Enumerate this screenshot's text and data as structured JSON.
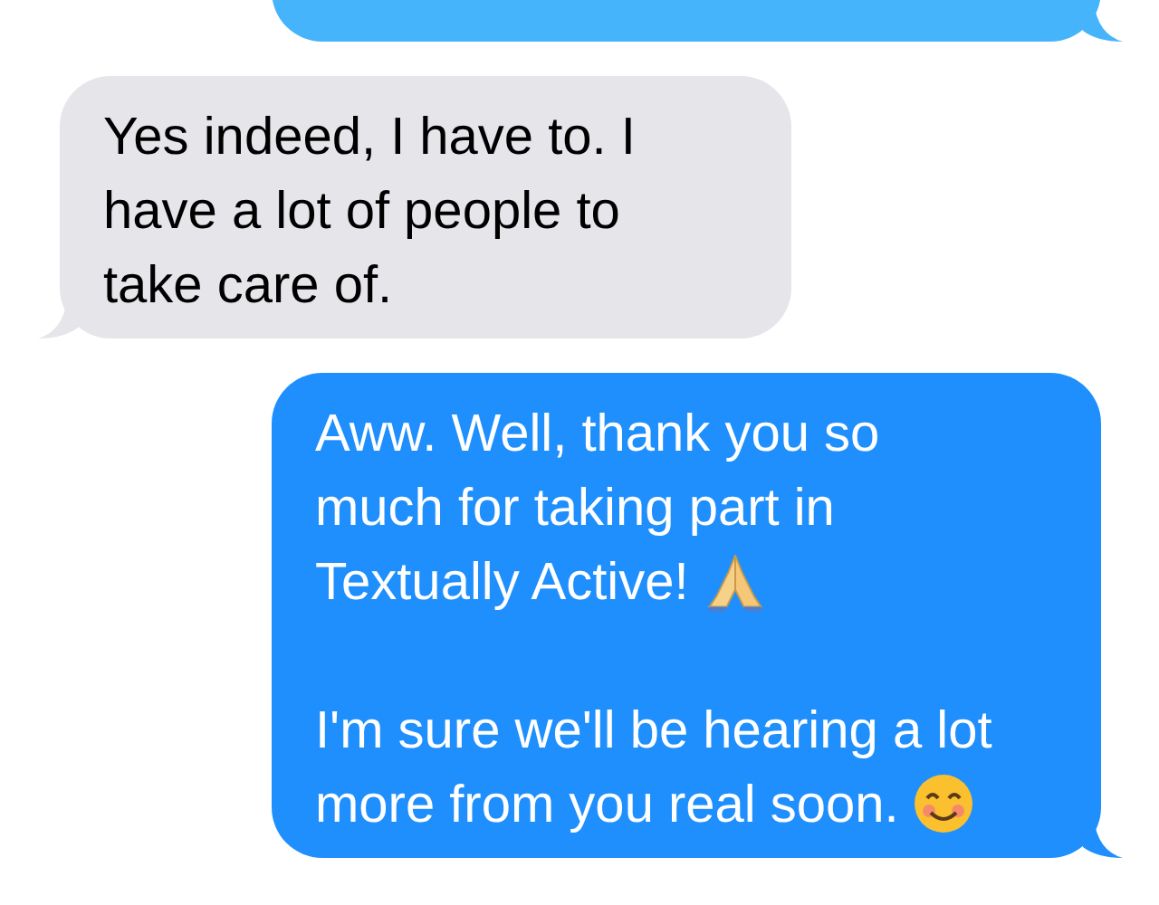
{
  "messages": [
    {
      "kind": "outgoing",
      "color": "#45b4fb"
    },
    {
      "kind": "incoming",
      "color": "#e5e5ea",
      "paragraphs": [
        {
          "text": "Yes indeed, I have to. I have a lot of people to take care of."
        }
      ]
    },
    {
      "kind": "outgoing",
      "color": "#1f8ffd",
      "paragraphs": [
        {
          "kind": "hands",
          "text": "Aww. Well, thank you so much for taking part in Textually Active!"
        },
        {
          "kind": "smile",
          "text": "I'm sure we'll be hearing a lot more from you real soon."
        }
      ]
    }
  ]
}
